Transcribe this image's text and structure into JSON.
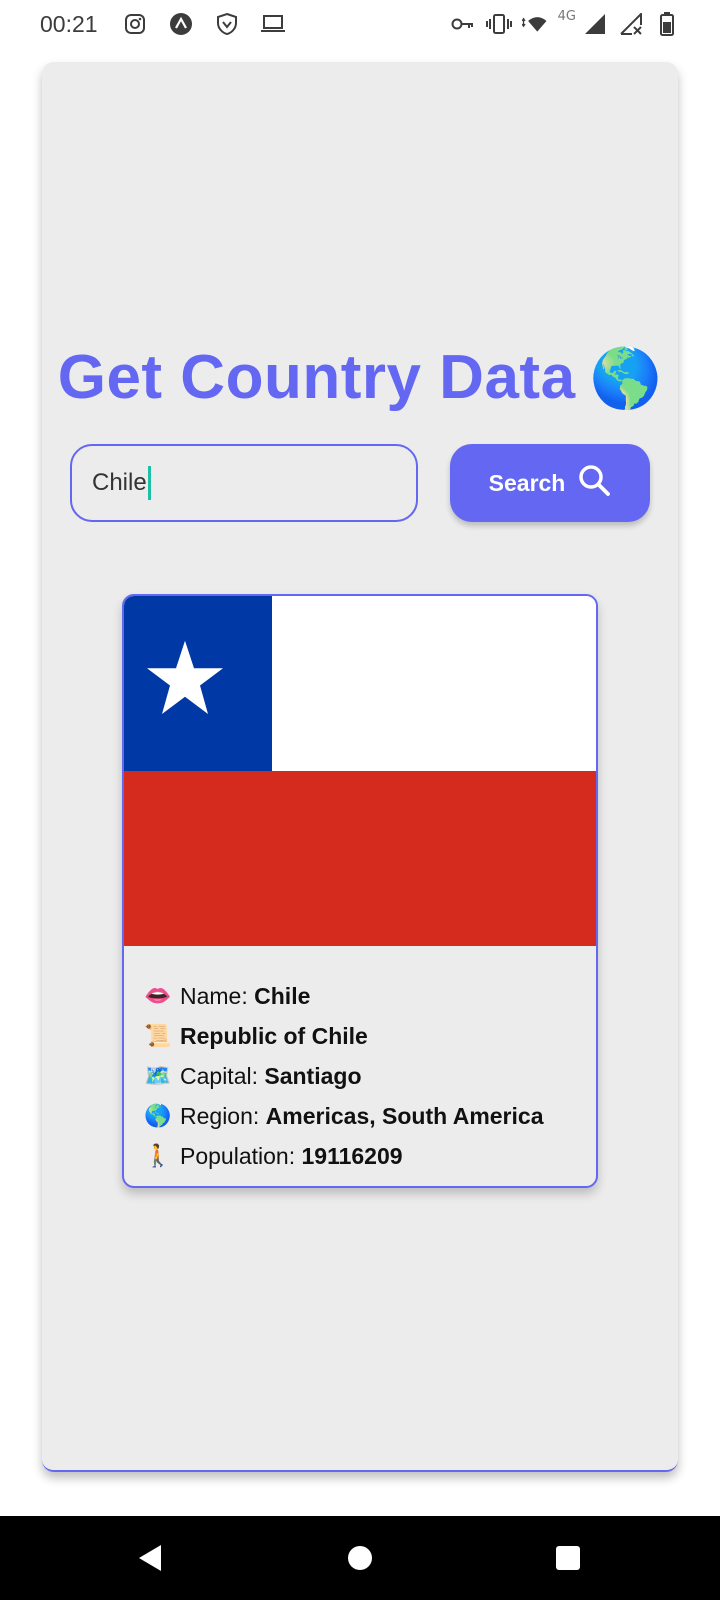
{
  "status": {
    "time": "00:21",
    "network": "4G",
    "left_icons": [
      "instagram-icon",
      "arc-icon",
      "shield-icon",
      "laptop-icon"
    ],
    "right_icons": [
      "vpn-key-icon",
      "vibrate-icon",
      "wifi-icon",
      "signal-icon",
      "signal-x-icon",
      "battery-icon"
    ]
  },
  "app": {
    "title": "Get Country Data",
    "title_emoji": "🌎",
    "accent_color": "#6467f2",
    "search": {
      "value": "Chile",
      "button_label": "Search"
    }
  },
  "result": {
    "flag": {
      "country": "Chile",
      "colors": {
        "blue": "#0039a6",
        "white": "#ffffff",
        "red": "#d52b1e"
      }
    },
    "rows": [
      {
        "emoji": "👄",
        "label": "Name: ",
        "value": "Chile"
      },
      {
        "emoji": "📜",
        "label": "",
        "value": "Republic of Chile"
      },
      {
        "emoji": "🗺️",
        "label": "Capital: ",
        "value": "Santiago"
      },
      {
        "emoji": "🌎",
        "label": "Region: ",
        "value": "Americas, South America"
      },
      {
        "emoji": "🚶",
        "label": "Population: ",
        "value": "19116209"
      }
    ]
  },
  "nav": {
    "buttons": [
      "back-icon",
      "home-icon",
      "recents-icon"
    ]
  }
}
